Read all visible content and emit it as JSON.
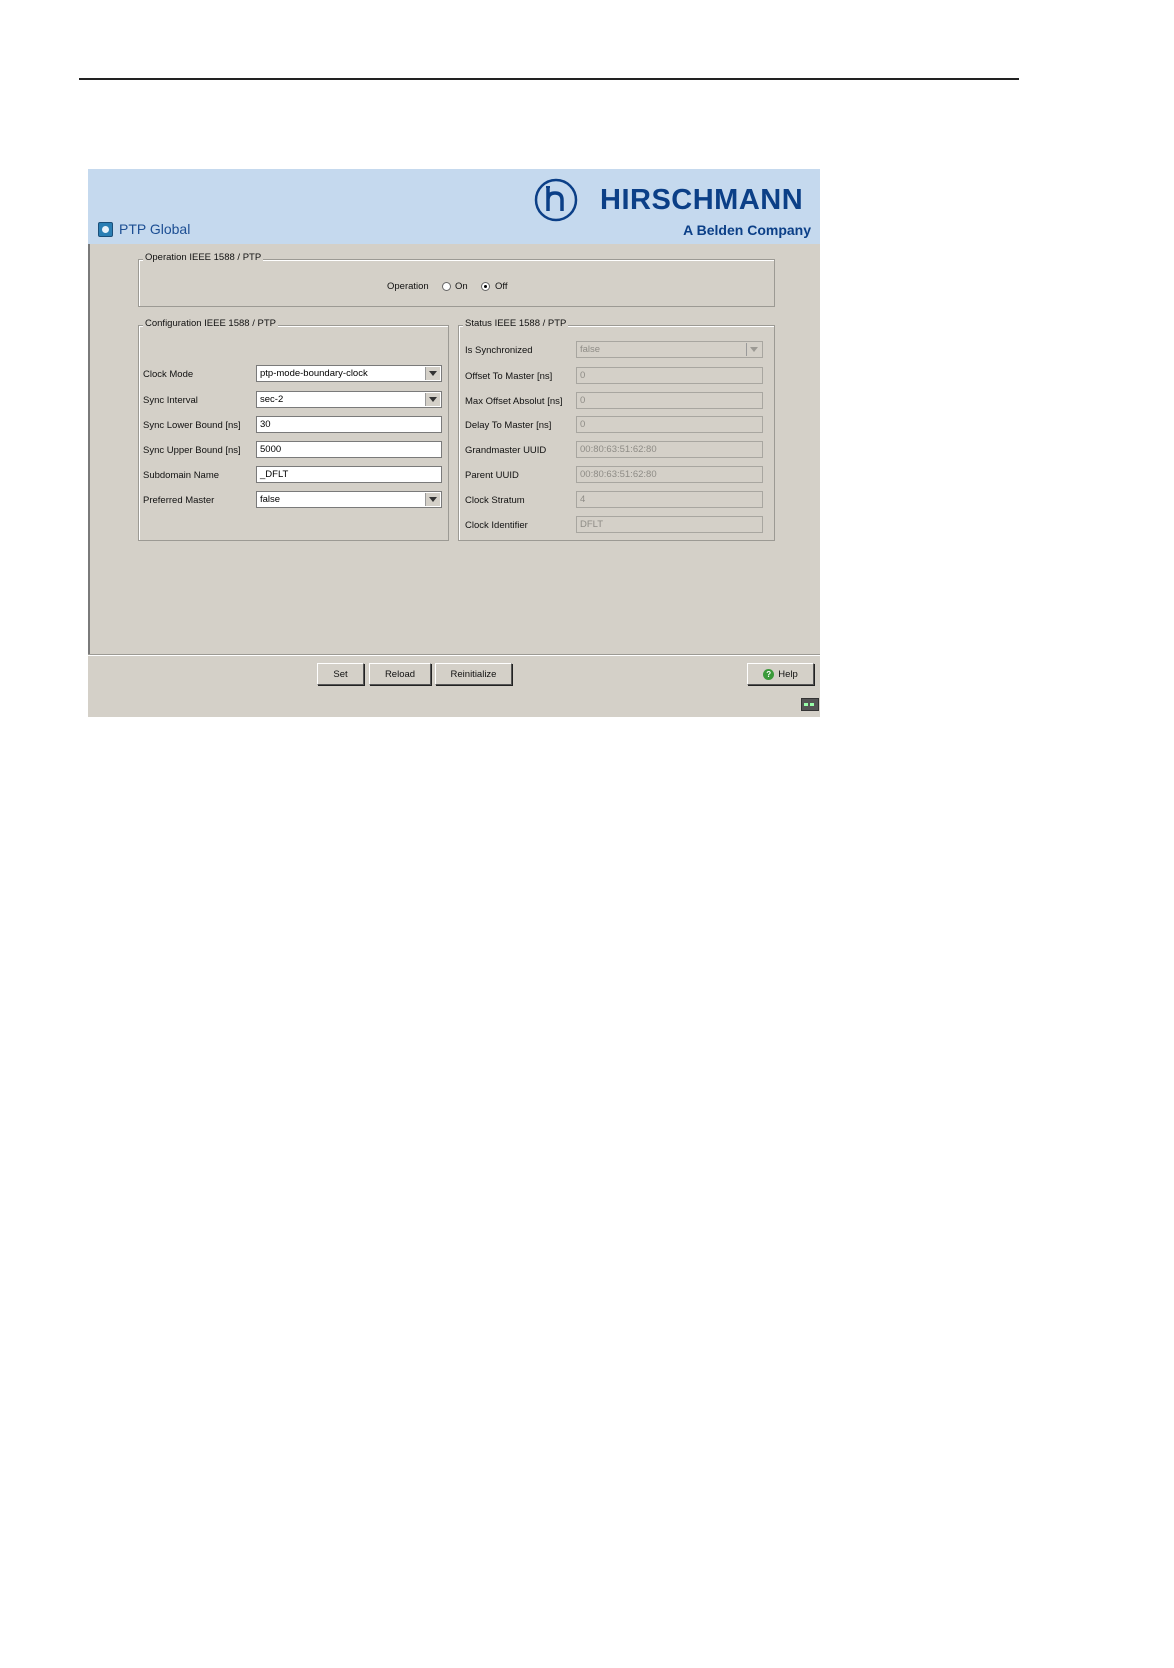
{
  "app": {
    "title": "PTP Global",
    "brand": "HIRSCHMANN",
    "brand_sub": "A Belden Company",
    "brand_color": "#0b3f87",
    "header_color": "#c5d9ee",
    "panel_color": "#d4d0c8"
  },
  "operation_group": {
    "legend": "Operation IEEE 1588 / PTP",
    "label": "Operation",
    "options": [
      {
        "label": "On",
        "selected": false
      },
      {
        "label": "Off",
        "selected": true
      }
    ]
  },
  "config_group": {
    "legend": "Configuration IEEE 1588 / PTP",
    "fields": [
      {
        "label": "Clock Mode",
        "value": "ptp-mode-boundary-clock",
        "type": "select"
      },
      {
        "label": "Sync Interval",
        "value": "sec-2",
        "type": "select"
      },
      {
        "label": "Sync Lower Bound [ns]",
        "value": "30",
        "type": "text"
      },
      {
        "label": "Sync Upper Bound [ns]",
        "value": "5000",
        "type": "text"
      },
      {
        "label": "Subdomain Name",
        "value": "_DFLT",
        "type": "text"
      },
      {
        "label": "Preferred Master",
        "value": "false",
        "type": "select"
      }
    ]
  },
  "status_group": {
    "legend": "Status IEEE 1588 / PTP",
    "fields": [
      {
        "label": "Is Synchronized",
        "value": "false",
        "type": "select"
      },
      {
        "label": "Offset To Master [ns]",
        "value": "0",
        "type": "text"
      },
      {
        "label": "Max Offset Absolut [ns]",
        "value": "0",
        "type": "text"
      },
      {
        "label": "Delay To Master [ns]",
        "value": "0",
        "type": "text"
      },
      {
        "label": "Grandmaster UUID",
        "value": "00:80:63:51:62:80",
        "type": "text"
      },
      {
        "label": "Parent UUID",
        "value": "00:80:63:51:62:80",
        "type": "text"
      },
      {
        "label": "Clock Stratum",
        "value": "4",
        "type": "text"
      },
      {
        "label": "Clock Identifier",
        "value": "DFLT",
        "type": "text"
      }
    ]
  },
  "footer": {
    "set_label": "Set",
    "reload_label": "Reload",
    "reinitialize_label": "Reinitialize",
    "help_label": "Help"
  },
  "icons": {
    "title": "ptp-global-icon",
    "logo": "hirschmann-logo-icon",
    "help": "help-icon",
    "status": "connection-status-icon"
  }
}
